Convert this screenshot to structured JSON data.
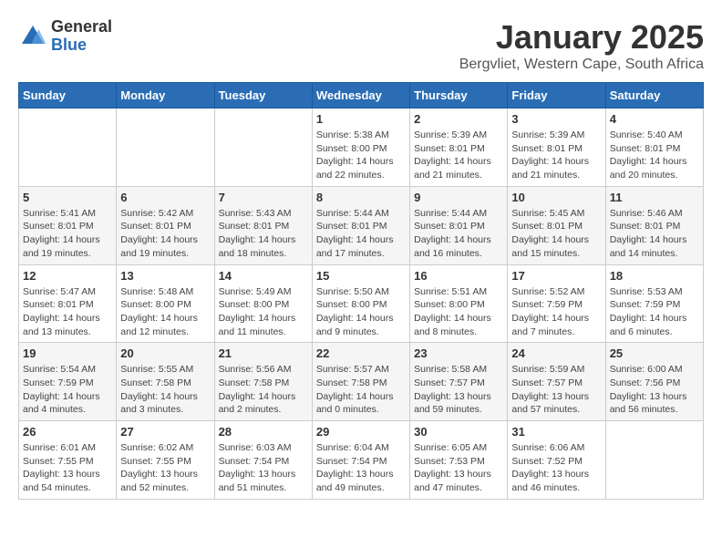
{
  "header": {
    "logo_line1": "General",
    "logo_line2": "Blue",
    "month": "January 2025",
    "location": "Bergvliet, Western Cape, South Africa"
  },
  "days_of_week": [
    "Sunday",
    "Monday",
    "Tuesday",
    "Wednesday",
    "Thursday",
    "Friday",
    "Saturday"
  ],
  "weeks": [
    [
      {
        "day": "",
        "info": ""
      },
      {
        "day": "",
        "info": ""
      },
      {
        "day": "",
        "info": ""
      },
      {
        "day": "1",
        "info": "Sunrise: 5:38 AM\nSunset: 8:00 PM\nDaylight: 14 hours and 22 minutes."
      },
      {
        "day": "2",
        "info": "Sunrise: 5:39 AM\nSunset: 8:01 PM\nDaylight: 14 hours and 21 minutes."
      },
      {
        "day": "3",
        "info": "Sunrise: 5:39 AM\nSunset: 8:01 PM\nDaylight: 14 hours and 21 minutes."
      },
      {
        "day": "4",
        "info": "Sunrise: 5:40 AM\nSunset: 8:01 PM\nDaylight: 14 hours and 20 minutes."
      }
    ],
    [
      {
        "day": "5",
        "info": "Sunrise: 5:41 AM\nSunset: 8:01 PM\nDaylight: 14 hours and 19 minutes."
      },
      {
        "day": "6",
        "info": "Sunrise: 5:42 AM\nSunset: 8:01 PM\nDaylight: 14 hours and 19 minutes."
      },
      {
        "day": "7",
        "info": "Sunrise: 5:43 AM\nSunset: 8:01 PM\nDaylight: 14 hours and 18 minutes."
      },
      {
        "day": "8",
        "info": "Sunrise: 5:44 AM\nSunset: 8:01 PM\nDaylight: 14 hours and 17 minutes."
      },
      {
        "day": "9",
        "info": "Sunrise: 5:44 AM\nSunset: 8:01 PM\nDaylight: 14 hours and 16 minutes."
      },
      {
        "day": "10",
        "info": "Sunrise: 5:45 AM\nSunset: 8:01 PM\nDaylight: 14 hours and 15 minutes."
      },
      {
        "day": "11",
        "info": "Sunrise: 5:46 AM\nSunset: 8:01 PM\nDaylight: 14 hours and 14 minutes."
      }
    ],
    [
      {
        "day": "12",
        "info": "Sunrise: 5:47 AM\nSunset: 8:01 PM\nDaylight: 14 hours and 13 minutes."
      },
      {
        "day": "13",
        "info": "Sunrise: 5:48 AM\nSunset: 8:00 PM\nDaylight: 14 hours and 12 minutes."
      },
      {
        "day": "14",
        "info": "Sunrise: 5:49 AM\nSunset: 8:00 PM\nDaylight: 14 hours and 11 minutes."
      },
      {
        "day": "15",
        "info": "Sunrise: 5:50 AM\nSunset: 8:00 PM\nDaylight: 14 hours and 9 minutes."
      },
      {
        "day": "16",
        "info": "Sunrise: 5:51 AM\nSunset: 8:00 PM\nDaylight: 14 hours and 8 minutes."
      },
      {
        "day": "17",
        "info": "Sunrise: 5:52 AM\nSunset: 7:59 PM\nDaylight: 14 hours and 7 minutes."
      },
      {
        "day": "18",
        "info": "Sunrise: 5:53 AM\nSunset: 7:59 PM\nDaylight: 14 hours and 6 minutes."
      }
    ],
    [
      {
        "day": "19",
        "info": "Sunrise: 5:54 AM\nSunset: 7:59 PM\nDaylight: 14 hours and 4 minutes."
      },
      {
        "day": "20",
        "info": "Sunrise: 5:55 AM\nSunset: 7:58 PM\nDaylight: 14 hours and 3 minutes."
      },
      {
        "day": "21",
        "info": "Sunrise: 5:56 AM\nSunset: 7:58 PM\nDaylight: 14 hours and 2 minutes."
      },
      {
        "day": "22",
        "info": "Sunrise: 5:57 AM\nSunset: 7:58 PM\nDaylight: 14 hours and 0 minutes."
      },
      {
        "day": "23",
        "info": "Sunrise: 5:58 AM\nSunset: 7:57 PM\nDaylight: 13 hours and 59 minutes."
      },
      {
        "day": "24",
        "info": "Sunrise: 5:59 AM\nSunset: 7:57 PM\nDaylight: 13 hours and 57 minutes."
      },
      {
        "day": "25",
        "info": "Sunrise: 6:00 AM\nSunset: 7:56 PM\nDaylight: 13 hours and 56 minutes."
      }
    ],
    [
      {
        "day": "26",
        "info": "Sunrise: 6:01 AM\nSunset: 7:55 PM\nDaylight: 13 hours and 54 minutes."
      },
      {
        "day": "27",
        "info": "Sunrise: 6:02 AM\nSunset: 7:55 PM\nDaylight: 13 hours and 52 minutes."
      },
      {
        "day": "28",
        "info": "Sunrise: 6:03 AM\nSunset: 7:54 PM\nDaylight: 13 hours and 51 minutes."
      },
      {
        "day": "29",
        "info": "Sunrise: 6:04 AM\nSunset: 7:54 PM\nDaylight: 13 hours and 49 minutes."
      },
      {
        "day": "30",
        "info": "Sunrise: 6:05 AM\nSunset: 7:53 PM\nDaylight: 13 hours and 47 minutes."
      },
      {
        "day": "31",
        "info": "Sunrise: 6:06 AM\nSunset: 7:52 PM\nDaylight: 13 hours and 46 minutes."
      },
      {
        "day": "",
        "info": ""
      }
    ]
  ]
}
